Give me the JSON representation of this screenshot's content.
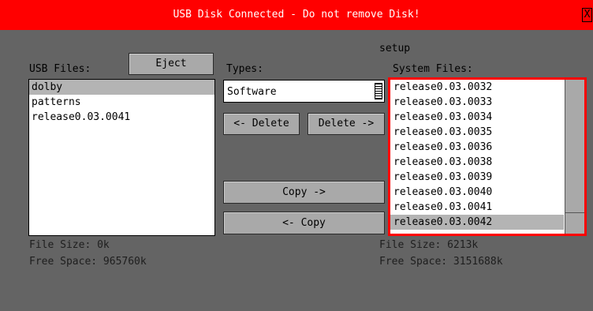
{
  "window": {
    "title": "USB Disk Connected - Do not remove Disk!",
    "close_label": "X",
    "accent_color": "#ff0000"
  },
  "setup_label": "setup",
  "usb": {
    "label": "USB Files:",
    "eject_label": "Eject",
    "files": [
      {
        "name": "dolby",
        "selected": true
      },
      {
        "name": "patterns",
        "selected": false
      },
      {
        "name": "release0.03.0041",
        "selected": false
      }
    ],
    "file_size": "File Size: 0k",
    "free_space": "Free Space: 965760k"
  },
  "types": {
    "label": "Types:",
    "selected": "Software"
  },
  "buttons": {
    "delete_left": "<- Delete",
    "delete_right": "Delete ->",
    "copy_right": "Copy ->",
    "copy_left": "<- Copy"
  },
  "system": {
    "label": "System Files:",
    "files": [
      {
        "name": "release0.03.0032",
        "selected": false
      },
      {
        "name": "release0.03.0033",
        "selected": false
      },
      {
        "name": "release0.03.0034",
        "selected": false
      },
      {
        "name": "release0.03.0035",
        "selected": false
      },
      {
        "name": "release0.03.0036",
        "selected": false
      },
      {
        "name": "release0.03.0038",
        "selected": false
      },
      {
        "name": "release0.03.0039",
        "selected": false
      },
      {
        "name": "release0.03.0040",
        "selected": false
      },
      {
        "name": "release0.03.0041",
        "selected": false
      },
      {
        "name": "release0.03.0042",
        "selected": true
      }
    ],
    "file_size": "File Size: 6213k",
    "free_space": "Free Space: 3151688k"
  }
}
